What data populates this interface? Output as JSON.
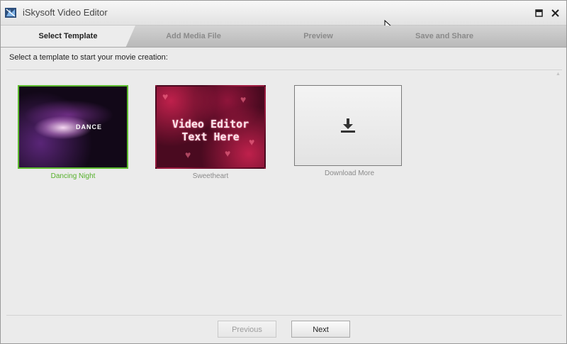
{
  "window": {
    "title": "iSkysoft Video Editor"
  },
  "tabs": [
    {
      "label": "Select Template",
      "active": true
    },
    {
      "label": "Add Media File",
      "active": false
    },
    {
      "label": "Preview",
      "active": false
    },
    {
      "label": "Save and Share",
      "active": false
    }
  ],
  "content": {
    "instruction": "Select a template to start your movie creation:",
    "templates": [
      {
        "caption": "Dancing Night",
        "selected": true,
        "preview_text": "DANCE"
      },
      {
        "caption": "Sweetheart",
        "selected": false,
        "preview_text_line1": "Video Editor",
        "preview_text_line2": "Text Here"
      },
      {
        "caption": "Download More",
        "selected": false,
        "icon": "download-icon"
      }
    ]
  },
  "footer": {
    "previous_label": "Previous",
    "next_label": "Next"
  },
  "colors": {
    "selected_accent": "#5dbb2f",
    "selected_caption": "#55b02a"
  }
}
